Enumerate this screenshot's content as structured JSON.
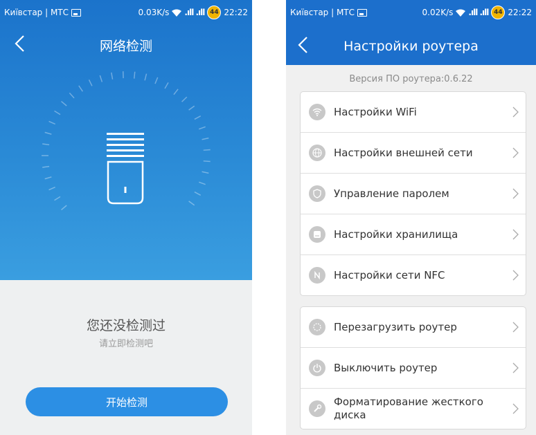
{
  "left": {
    "status": {
      "carrier": "Київстар | МТС",
      "speed": "0.03K/s",
      "signal": ".ıll .ıll",
      "battery": "44",
      "time": "22:22"
    },
    "title": "网络检测",
    "message": "您还没检测过",
    "sub_message": "请立即检测吧",
    "start_button": "开始检测"
  },
  "right": {
    "status": {
      "carrier": "Київстар | МТС",
      "speed": "0.02K/s",
      "signal": ".ıll .ıll",
      "battery": "44",
      "time": "22:22"
    },
    "title": "Настройки роутера",
    "firmware": "Версия ПО роутера:0.6.22",
    "group1": [
      {
        "label": "Настройки WiFi",
        "icon": "wifi-icon"
      },
      {
        "label": "Настройки внешней сети",
        "icon": "globe-icon"
      },
      {
        "label": "Управление паролем",
        "icon": "shield-icon"
      },
      {
        "label": "Настройки хранилища",
        "icon": "storage-icon"
      },
      {
        "label": "Настройки сети NFC",
        "icon": "nfc-icon"
      }
    ],
    "group2": [
      {
        "label": "Перезагрузить роутер",
        "icon": "restart-icon"
      },
      {
        "label": "Выключить роутер",
        "icon": "power-icon"
      },
      {
        "label": "Форматирование жесткого диска",
        "icon": "wrench-icon"
      }
    ]
  },
  "colors": {
    "header_blue": "#1c6fcc",
    "button_blue": "#2c8fe4",
    "icon_gray": "#c8c8c8"
  }
}
